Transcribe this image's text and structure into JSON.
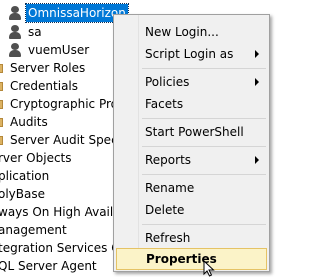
{
  "tree": {
    "items": [
      {
        "label": "OmnissaHorizon",
        "icon": "user-icon",
        "selected": true
      },
      {
        "label": "sa",
        "icon": "user-icon",
        "selected": false
      },
      {
        "label": "vuemUser",
        "icon": "user-icon",
        "selected": false
      },
      {
        "label": "Server Roles",
        "icon": "folder-icon",
        "selected": false
      },
      {
        "label": "Credentials",
        "icon": "folder-icon",
        "selected": false
      },
      {
        "label": "Cryptographic Prov",
        "icon": "folder-icon",
        "selected": false
      },
      {
        "label": "Audits",
        "icon": "folder-icon",
        "selected": false
      },
      {
        "label": "Server Audit Specifi",
        "icon": "folder-icon",
        "selected": false
      },
      {
        "label": "rver Objects",
        "icon": "",
        "selected": false
      },
      {
        "label": "plication",
        "icon": "",
        "selected": false
      },
      {
        "label": "olyBase",
        "icon": "",
        "selected": false
      },
      {
        "label": "ways On High Availa",
        "icon": "",
        "selected": false
      },
      {
        "label": "anagement",
        "icon": "",
        "selected": false
      },
      {
        "label": "tegration Services Ca",
        "icon": "",
        "selected": false
      },
      {
        "label": "QL Server Agent",
        "icon": "",
        "selected": false
      }
    ]
  },
  "context_menu": {
    "items": [
      {
        "label": "New Login...",
        "submenu": false
      },
      {
        "label": "Script Login as",
        "submenu": true
      },
      {
        "label": "Policies",
        "submenu": true
      },
      {
        "label": "Facets",
        "submenu": false
      },
      {
        "label": "Start PowerShell",
        "submenu": false
      },
      {
        "label": "Reports",
        "submenu": true
      },
      {
        "label": "Rename",
        "submenu": false
      },
      {
        "label": "Delete",
        "submenu": false
      },
      {
        "label": "Refresh",
        "submenu": false
      },
      {
        "label": "Properties",
        "submenu": false,
        "highlighted": true
      }
    ]
  },
  "colors": {
    "selection": "#0078d7",
    "menu_background": "#f0f0f0",
    "menu_highlight": "#fbf3c8",
    "folder": "#dcb262"
  }
}
